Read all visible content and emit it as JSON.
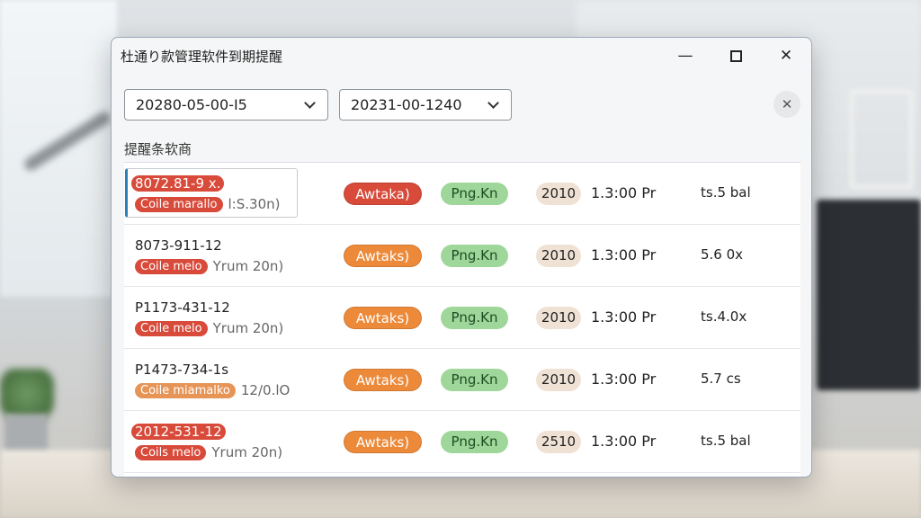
{
  "window": {
    "title": "杜通り款管理软件到期提醒"
  },
  "filters": {
    "start_date": "20280-05-00-I5",
    "end_date": "20231-00-1240"
  },
  "section_label": "提醒条软商",
  "rows": [
    {
      "id": "8072.81-9 x.",
      "sub_pill": "Coile marallo",
      "sub_rest": "l:S.30n)",
      "status": "Awtaka)",
      "status_color": "#d84a3a",
      "tag": "Png.Kn",
      "year": "2010",
      "time": "1.3:00 Pr",
      "rate": "ts.5 bal"
    },
    {
      "id": "8073-911-12",
      "sub_pill": "Coile melo",
      "sub_rest": "Yrum 20n)",
      "status": "Awtaks)",
      "status_color": "#ec8a3a",
      "tag": "Png.Kn",
      "year": "2010",
      "time": "1.3:00 Pr",
      "rate": "5.6 0x"
    },
    {
      "id": "P1173-431-12",
      "sub_pill": "Coile melo",
      "sub_rest": "Yrum 20n)",
      "status": "Awtaks)",
      "status_color": "#ec8a3a",
      "tag": "Png.Kn",
      "year": "2010",
      "time": "1.3:00 Pr",
      "rate": "ts.4.0x"
    },
    {
      "id": "P1473-734-1s",
      "sub_pill": "Coile miamalko",
      "sub_rest": "12/0.lO",
      "status": "Awtaks)",
      "status_color": "#ec8a3a",
      "tag": "Png.Kn",
      "year": "2010",
      "time": "1.3:00 Pr",
      "rate": "5.7 cs"
    },
    {
      "id": "2012-531-12",
      "sub_pill": "Coils melo",
      "sub_rest": "Yrum 20n)",
      "status": "Awtaks)",
      "status_color": "#ec8a3a",
      "tag": "Png.Kn",
      "year": "2510",
      "time": "1.3:00 Pr",
      "rate": "ts.5 bal"
    }
  ],
  "icons": {
    "minimize": "minimize-icon",
    "maximize": "maximize-icon",
    "close": "close-icon",
    "dropdown": "chevron-down-icon",
    "clear": "clear-icon"
  }
}
